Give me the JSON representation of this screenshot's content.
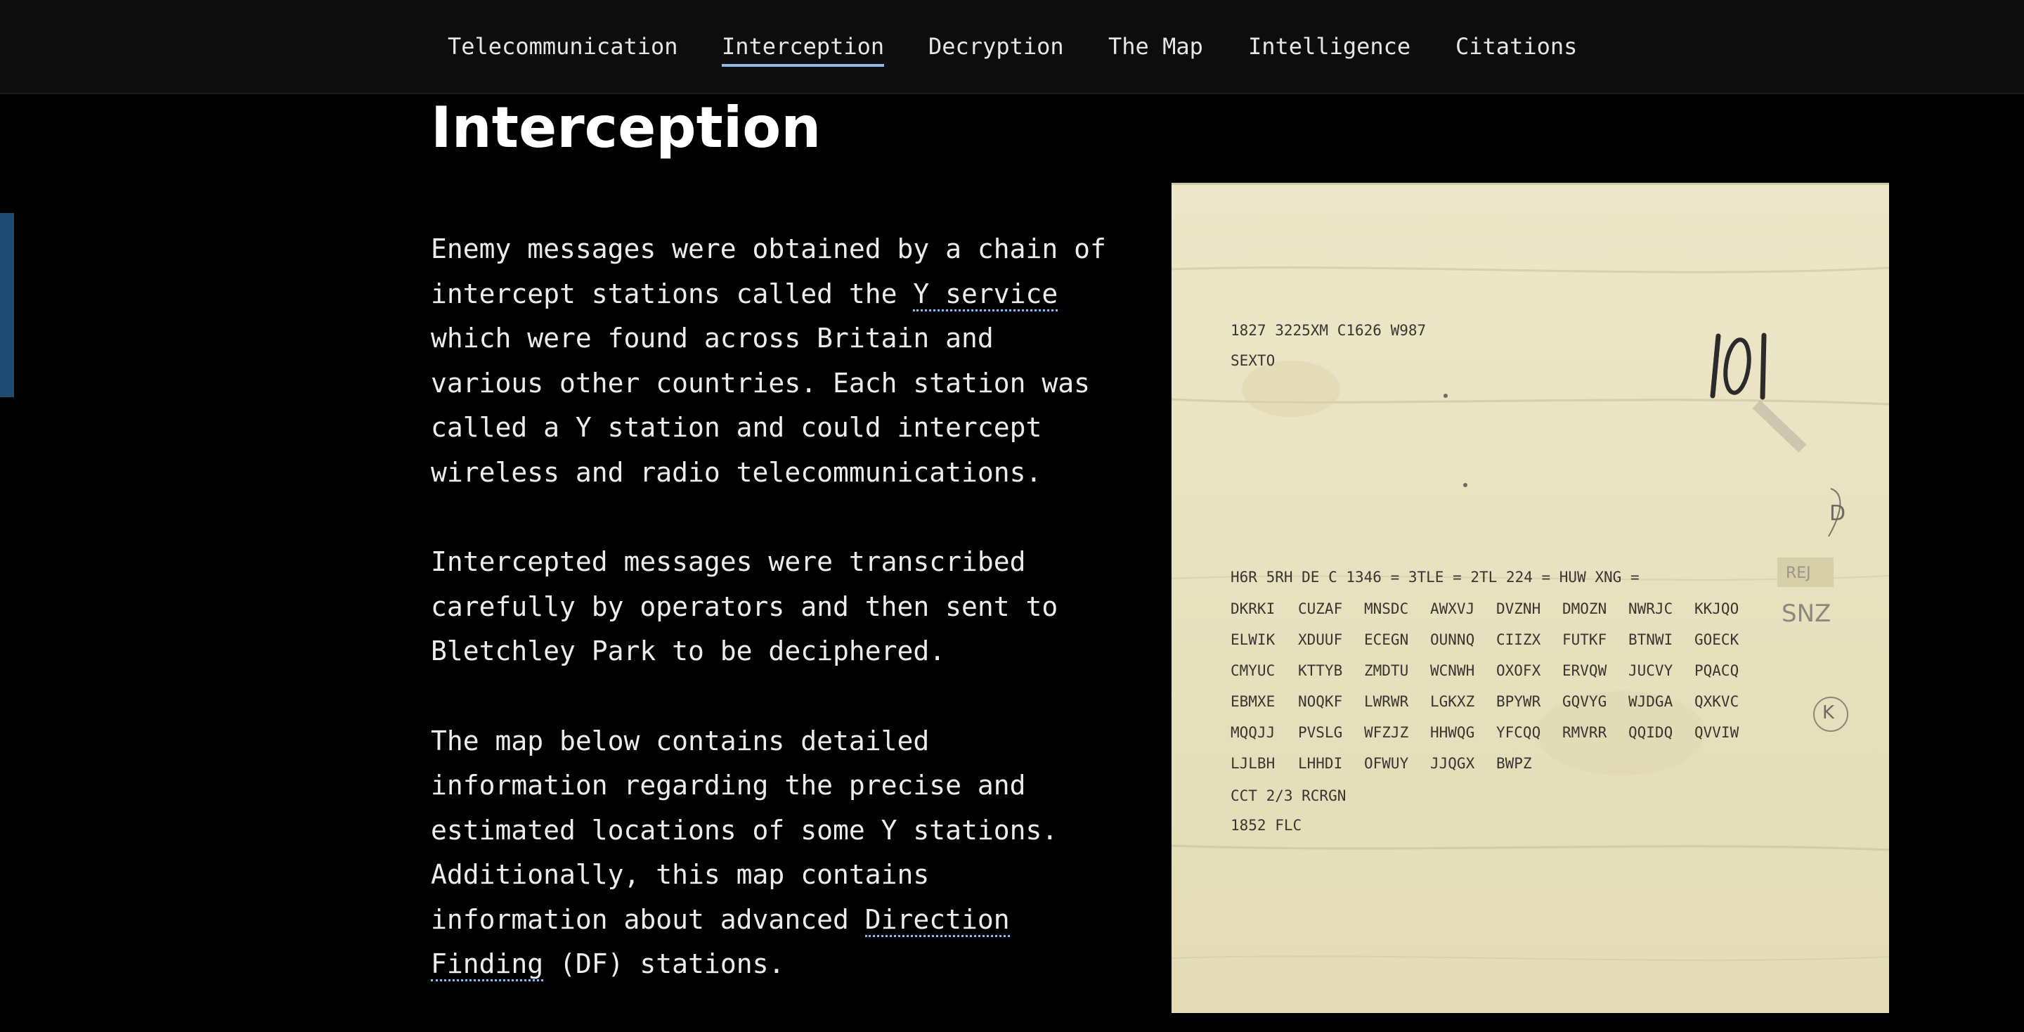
{
  "nav": {
    "items": [
      {
        "label": "Telecommunication"
      },
      {
        "label": "Interception",
        "active": true
      },
      {
        "label": "Decryption"
      },
      {
        "label": "The Map"
      },
      {
        "label": "Intelligence"
      },
      {
        "label": "Citations"
      }
    ],
    "active_color": "#8fb8ec"
  },
  "page": {
    "title": "Interception",
    "paragraph1": {
      "before": "Enemy messages were obtained by a chain of intercept stations called the ",
      "link": "Y service",
      "after": " which were found across Britain and various other countries. Each station was called a Y station and could intercept wireless and radio telecommunications."
    },
    "paragraph2": "Intercepted messages were transcribed carefully by operators and then sent to Bletchley Park to be deciphered.",
    "paragraph3": {
      "before": "The map below contains detailed information regarding the precise and estimated locations of some Y stations. Additionally, this map contains information about advanced ",
      "link": "Direction Finding",
      "after": " (DF) stations."
    }
  },
  "document": {
    "header_line": "1827  3225XM  C1626  W987",
    "header_line2": "SEXTO",
    "preamble": "H6R  5RH DE C  1346 = 3TLE  = 2TL  224 = HUW XNG  =",
    "rows": [
      [
        "DKRKI",
        "CUZAF",
        "MNSDC",
        "AWXVJ",
        "DVZNH",
        "DMOZN",
        "NWRJC",
        "KKJQO"
      ],
      [
        "ELWIK",
        "XDUUF",
        "ECEGN",
        "OUNNQ",
        "CIIZX",
        "FUTKF",
        "BTNWI",
        "GOECK"
      ],
      [
        "CMYUC",
        "KTTYB",
        "ZMDTU",
        "WCNWH",
        "OXOFX",
        "ERVQW",
        "JUCVY",
        "PQACQ"
      ],
      [
        "EBMXE",
        "NOQKF",
        "LWRWR",
        "LGKXZ",
        "BPYWR",
        "GQVYG",
        "WJDGA",
        "QXKVC"
      ],
      [
        "MQQJJ",
        "PVSLG",
        "WFZJZ",
        "HHWQG",
        "YFCQQ",
        "RMVRR",
        "QQIDQ",
        "QVVIW"
      ],
      [
        "LJLBH",
        "LHHDI",
        "OFWUY",
        "JJQGX",
        "BWPZ"
      ]
    ],
    "footer_line": "CCT  2/3  RCRGN",
    "footer_line2": "1852 FLC",
    "handwritten_number": "101",
    "margin_note_1": "REJ",
    "margin_note_2": "SNZ",
    "margin_note_3": "K",
    "margin_note_4": "D"
  }
}
